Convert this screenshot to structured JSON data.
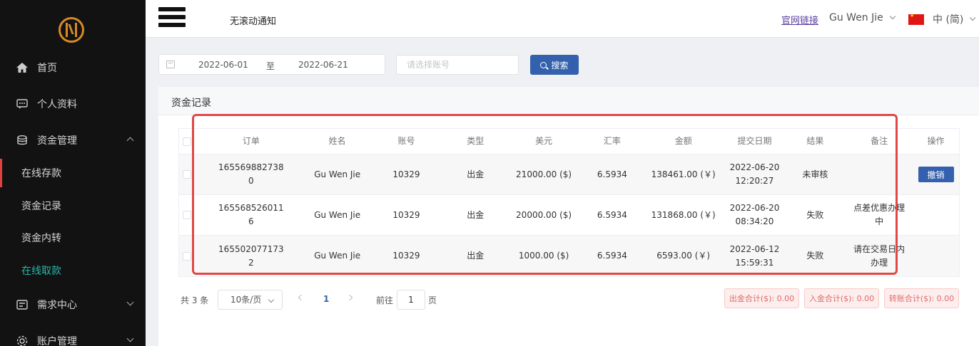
{
  "sidebar": {
    "items": [
      {
        "label": "首页",
        "icon": "home-icon"
      },
      {
        "label": "个人资料",
        "icon": "profile-icon"
      },
      {
        "label": "资金管理",
        "icon": "funds-icon"
      },
      {
        "label": "需求中心",
        "icon": "request-icon"
      },
      {
        "label": "账户管理",
        "icon": "account-icon"
      }
    ],
    "sub_items": [
      {
        "label": "在线存款"
      },
      {
        "label": "资金记录"
      },
      {
        "label": "资金内转"
      },
      {
        "label": "在线取款"
      }
    ],
    "active_color": "#27b7a7"
  },
  "header": {
    "notice": "无滚动通知",
    "official_link": "官网链接",
    "user_name": "Gu Wen Jie",
    "language": "中 (简)"
  },
  "filter": {
    "date_start": "2022-06-01",
    "date_separator": "至",
    "date_end": "2022-06-21",
    "account_placeholder": "请选择账号",
    "search_label": "搜索"
  },
  "card": {
    "title": "资金记录"
  },
  "table": {
    "columns": [
      "订单",
      "姓名",
      "账号",
      "类型",
      "美元",
      "汇率",
      "金额",
      "提交日期",
      "结果",
      "备注",
      "操作"
    ],
    "rows": [
      {
        "order": "1655698827380",
        "name": "Gu Wen Jie",
        "account": "10329",
        "type": "出金",
        "usd": "21000.00 ($)",
        "rate": "6.5934",
        "amount": "138461.00 (￥)",
        "date": "2022-06-20 12:20:27",
        "result": "未审核",
        "remark": "",
        "action": "撤销"
      },
      {
        "order": "1655685260116",
        "name": "Gu Wen Jie",
        "account": "10329",
        "type": "出金",
        "usd": "20000.00 ($)",
        "rate": "6.5934",
        "amount": "131868.00 (￥)",
        "date": "2022-06-20 08:34:20",
        "result": "失败",
        "remark": "点差优惠办理中",
        "action": ""
      },
      {
        "order": "1655020771732",
        "name": "Gu Wen Jie",
        "account": "10329",
        "type": "出金",
        "usd": "1000.00 ($)",
        "rate": "6.5934",
        "amount": "6593.00 (￥)",
        "date": "2022-06-12 15:59:31",
        "result": "失败",
        "remark": "请在交易日内办理",
        "action": ""
      }
    ]
  },
  "pagination": {
    "total": "共 3 条",
    "page_size": "10条/页",
    "current_page": "1",
    "goto_label": "前往",
    "goto_value": "1",
    "page_unit": "页"
  },
  "summary": {
    "withdraw_total": "出金合计($): 0.00",
    "deposit_total": "入金合计($): 0.00",
    "transfer_total": "转账合计($): 0.00"
  },
  "colors": {
    "primary": "#3361ae",
    "highlight_border": "#e04848",
    "sidebar_bg": "#121212"
  }
}
